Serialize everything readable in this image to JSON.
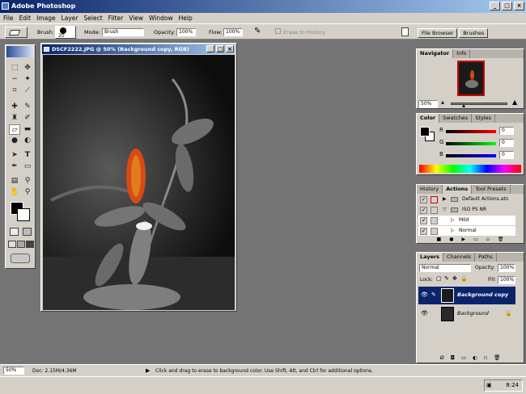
{
  "app": {
    "title": "Adobe Photoshop",
    "win_min": "_",
    "win_max": "□",
    "win_close": "×"
  },
  "menu": [
    "File",
    "Edit",
    "Image",
    "Layer",
    "Select",
    "Filter",
    "View",
    "Window",
    "Help"
  ],
  "options": {
    "brush_label": "Brush:",
    "brush_size": "20",
    "mode_label": "Mode:",
    "mode_value": "Brush",
    "opacity_label": "Opacity:",
    "opacity_value": "100%",
    "flow_label": "Flow:",
    "flow_value": "100%",
    "erase_history": "Erase to History",
    "well_tabs": [
      "File Browser",
      "Brushes"
    ]
  },
  "document": {
    "title": "DSCF2222.JPG @ 50% (Background copy, RGB)"
  },
  "navigator": {
    "tabs": [
      "Navigator",
      "Info"
    ],
    "zoom": "50%"
  },
  "color": {
    "tabs": [
      "Color",
      "Swatches",
      "Styles"
    ],
    "r_label": "R",
    "g_label": "G",
    "b_label": "B",
    "r": "0",
    "g": "0",
    "b": "0"
  },
  "actions": {
    "tabs": [
      "History",
      "Actions",
      "Tool Presets"
    ],
    "items": [
      {
        "label": "Default Actions.atn",
        "kind": "set"
      },
      {
        "label": "ISO PS NR",
        "kind": "set"
      },
      {
        "label": "Mild",
        "kind": "action"
      },
      {
        "label": "Normal",
        "kind": "action"
      }
    ]
  },
  "layers": {
    "tabs": [
      "Layers",
      "Channels",
      "Paths"
    ],
    "blend": "Normal",
    "opacity_label": "Opacity:",
    "opacity": "100%",
    "lock_label": "Lock:",
    "fill_label": "Fill:",
    "fill": "100%",
    "items": [
      {
        "name": "Background copy",
        "selected": true
      },
      {
        "name": "Background",
        "selected": false
      }
    ]
  },
  "status": {
    "zoom": "50%",
    "doc": "Doc: 2.15M/4.36M",
    "hint": "Click and drag to erase to background color. Use Shift, Alt, and Ctrl for additional options."
  },
  "taskbar": {
    "time": "8:24"
  },
  "colors": {
    "title_start": "#0a246a",
    "title_end": "#a6caf0",
    "chrome": "#d4d0c8",
    "workspace": "#747474",
    "selection": "#0a246a"
  }
}
